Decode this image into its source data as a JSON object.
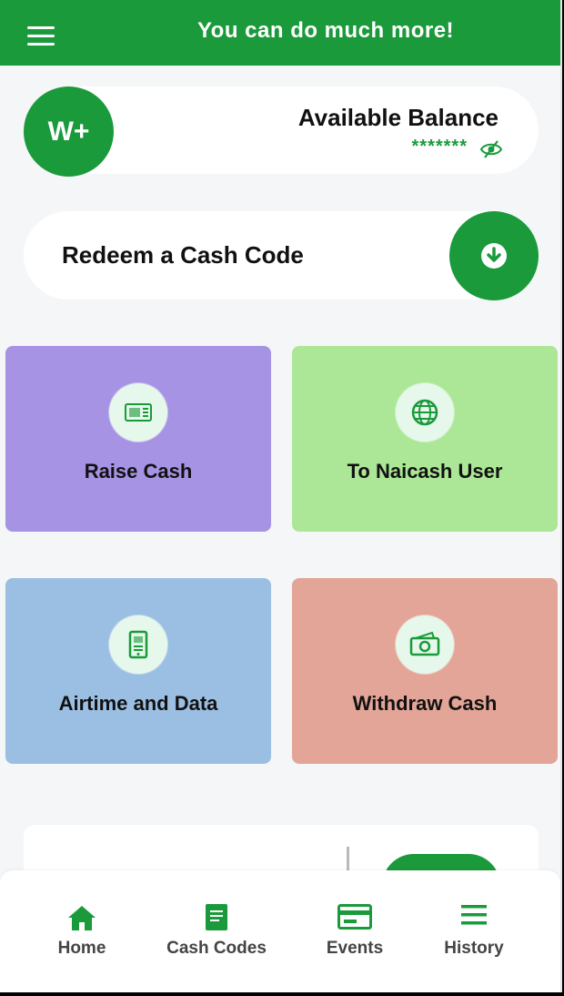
{
  "header": {
    "title": "You can do much more!"
  },
  "balance": {
    "logo_text": "W+",
    "label": "Available Balance",
    "masked_value": "*******"
  },
  "redeem": {
    "label": "Redeem a Cash Code"
  },
  "actions": [
    {
      "label": "Raise Cash",
      "icon": "ticket-icon",
      "color": "#a693e3"
    },
    {
      "label": "To Naicash User",
      "icon": "globe-icon",
      "color": "#abe796"
    },
    {
      "label": "Airtime and Data",
      "icon": "phone-device-icon",
      "color": "#9bbfe3"
    },
    {
      "label": "Withdraw Cash",
      "icon": "cash-icon",
      "color": "#e3a597"
    }
  ],
  "nav": [
    {
      "label": "Home",
      "icon": "home-icon"
    },
    {
      "label": "Cash Codes",
      "icon": "document-icon"
    },
    {
      "label": "Events",
      "icon": "card-icon"
    },
    {
      "label": "History",
      "icon": "list-icon"
    }
  ],
  "colors": {
    "brand": "#1a9a3b",
    "background": "#f4f6f7"
  }
}
